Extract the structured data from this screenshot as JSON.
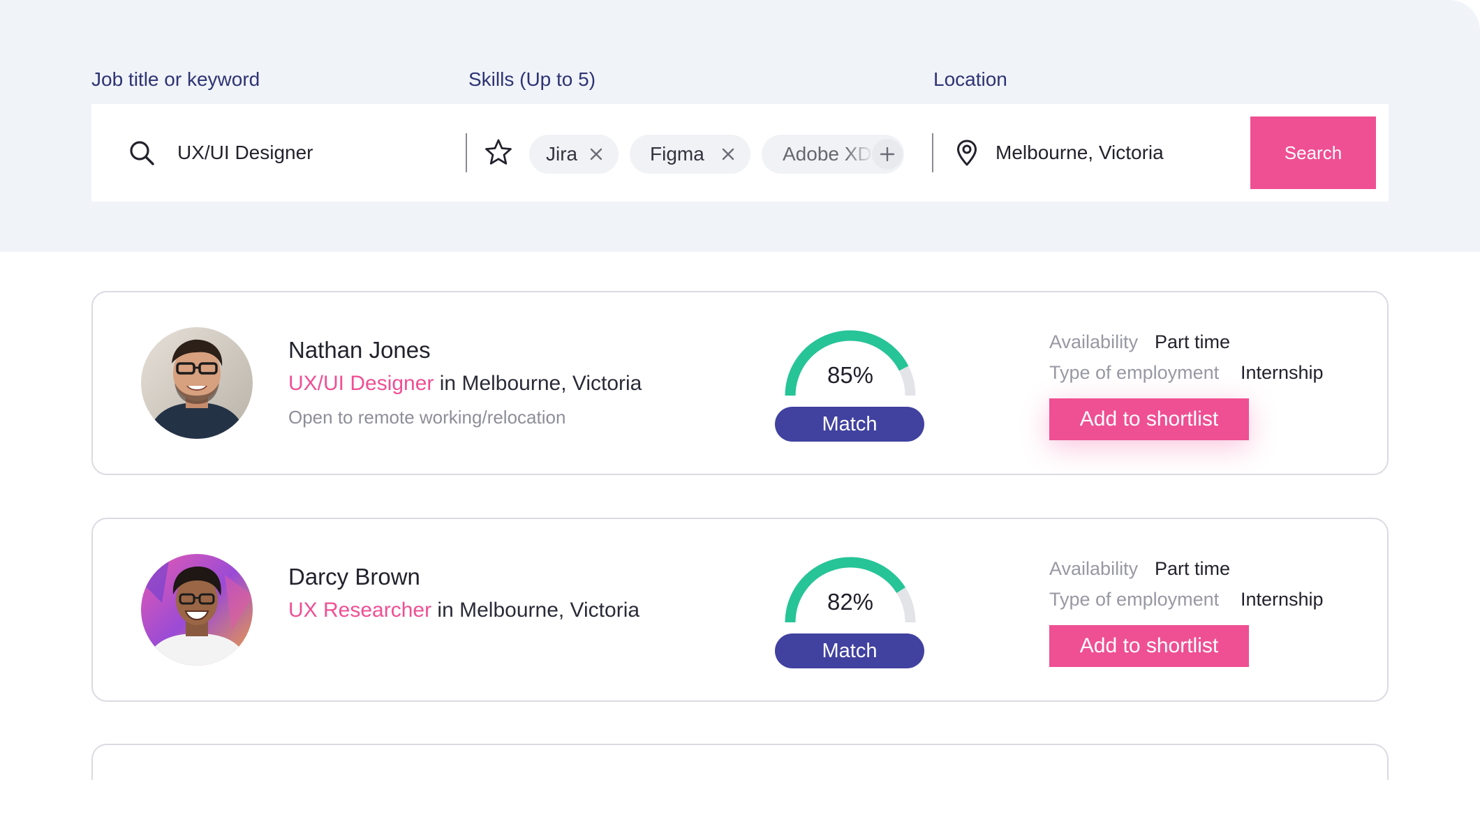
{
  "search": {
    "keyword_label": "Job title or keyword",
    "keyword_value": "UX/UI Designer",
    "skills_label": "Skills (Up to 5)",
    "skills": [
      "Jira",
      "Figma",
      "Adobe XD"
    ],
    "location_label": "Location",
    "location_value": "Melbourne, Victoria",
    "button_label": "Search"
  },
  "candidates": [
    {
      "name": "Nathan Jones",
      "role": "UX/UI Designer",
      "in": "in",
      "location": "Melbourne, Victoria",
      "note": "Open to remote working/relocation",
      "match_percent": "85%",
      "match_value": 0.85,
      "match_label": "Match",
      "availability_label": "Availability",
      "availability": "Part time",
      "employment_label": "Type of employment",
      "employment": "Internship",
      "button_label": "Add to shortlist"
    },
    {
      "name": "Darcy Brown",
      "role": "UX Researcher",
      "in": "in",
      "location": "Melbourne, Victoria",
      "note": "",
      "match_percent": "82%",
      "match_value": 0.82,
      "match_label": "Match",
      "availability_label": "Availability",
      "availability": "Part time",
      "employment_label": "Type of employment",
      "employment": "Internship",
      "button_label": "Add to shortlist"
    }
  ],
  "colors": {
    "accent_pink": "#ef4f93",
    "navy": "#2e3374",
    "match_pill": "#4141a0",
    "gauge_fill": "#26c497",
    "gauge_track": "#e3e4e8",
    "band_bg": "#f0f3f8"
  },
  "icons": {
    "keyword": "search-icon",
    "skills": "star-icon",
    "chip_remove": "close-icon",
    "chip_add": "plus-icon",
    "location": "location-pin-icon"
  }
}
